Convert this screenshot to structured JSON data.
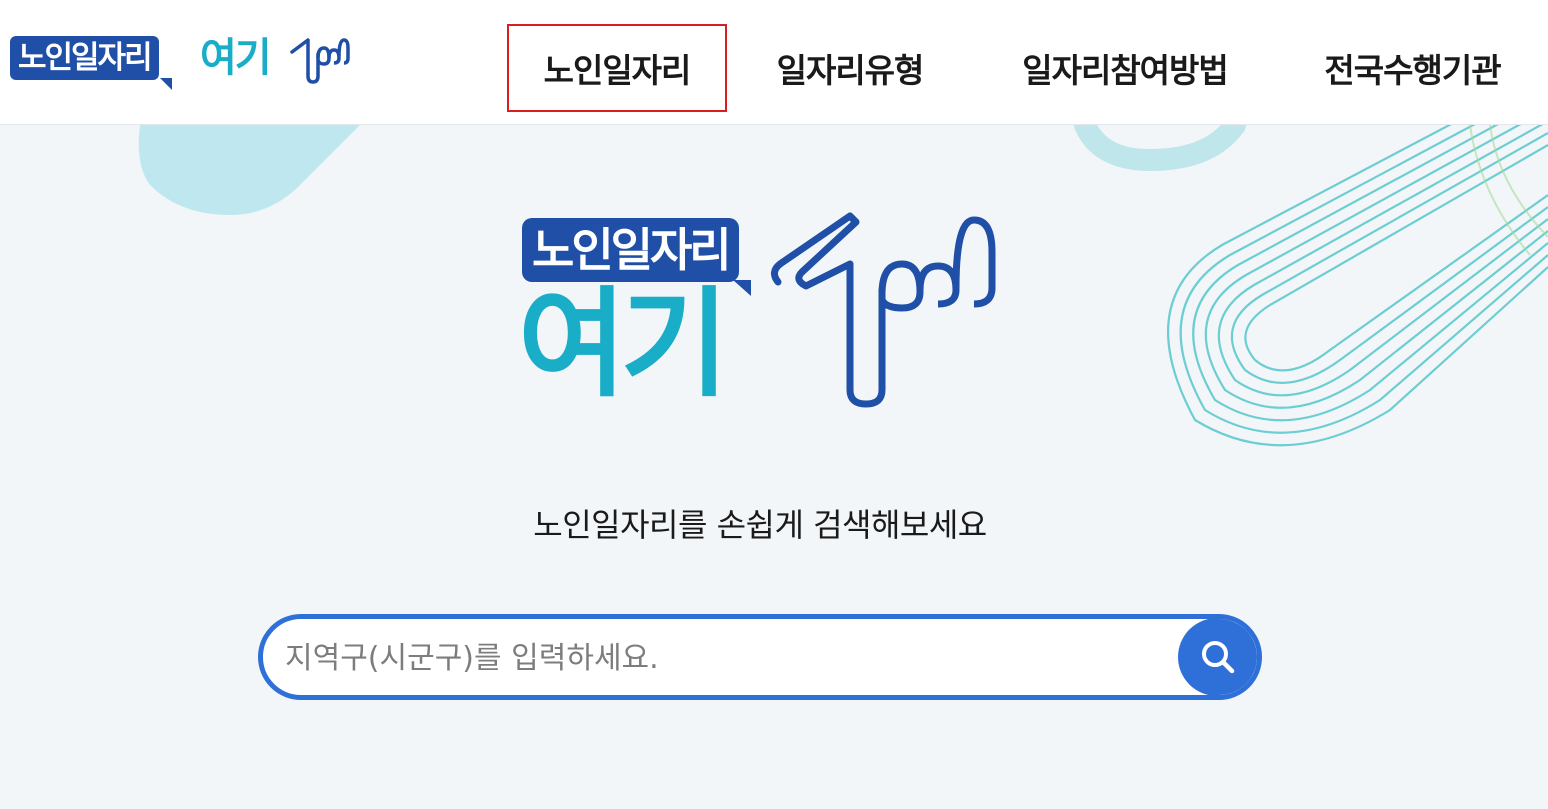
{
  "brand": {
    "badge_text": "노인일자리",
    "highlight_text": "여기",
    "colors": {
      "badge": "#1f4fa6",
      "highlight": "#1aadc7"
    }
  },
  "nav": {
    "items": [
      {
        "label": "노인일자리",
        "active": true
      },
      {
        "label": "일자리유형",
        "active": false
      },
      {
        "label": "일자리참여방법",
        "active": false
      },
      {
        "label": "전국수행기관",
        "active": false
      }
    ]
  },
  "hero": {
    "tagline": "노인일자리를 손쉽게 검색해보세요"
  },
  "search": {
    "placeholder": "지역구(시군구)를 입력하세요.",
    "value": "",
    "button_icon": "search-icon",
    "accent": "#2f6fd8"
  },
  "colors": {
    "active_outline": "#d81e1e",
    "background": "#f2f6f9"
  }
}
